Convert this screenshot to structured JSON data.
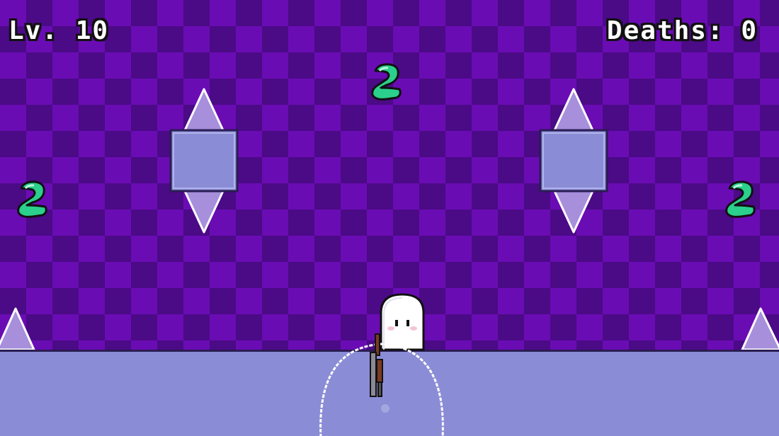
{
  "hud": {
    "level_label": "Lv. 10",
    "deaths_label": "Deaths: 0"
  },
  "palette": {
    "background_light": "#6a0cb4",
    "background_dark": "#4b0a86",
    "block_fill": "#8b8cd6",
    "spike_fill": "#a78fdc",
    "collectible": "#2ad08c",
    "ghost": "#ffffff"
  },
  "sprites": {
    "player": "ghost-player",
    "collectible": "green-soul-icon",
    "hazard": "spike-icon",
    "weapon": "rifle"
  }
}
